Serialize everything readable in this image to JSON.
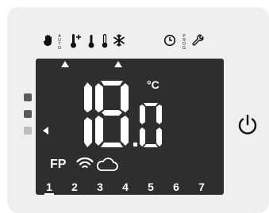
{
  "display": {
    "temperature_int": "18",
    "temperature_dec": "0",
    "unit": "°C",
    "mode_label": "FP",
    "icons": {
      "manual": "hand-icon",
      "auto": "auto-label",
      "comfort": "thermometer-plus-icon",
      "eco": "thermometer-icon",
      "thermo2": "thermometer-small-icon",
      "frost": "snowflake-icon",
      "clock": "clock-icon",
      "prog": "prog-label",
      "settings": "wrench-icon",
      "wifi": "wifi-icon",
      "cloud": "cloud-icon",
      "power": "power-icon"
    },
    "auto_text": "AUTO",
    "prog_text": "PROG"
  },
  "days": [
    {
      "label": "1",
      "active": true
    },
    {
      "label": "2",
      "active": false
    },
    {
      "label": "3",
      "active": false
    },
    {
      "label": "4",
      "active": false
    },
    {
      "label": "5",
      "active": false
    },
    {
      "label": "6",
      "active": false
    },
    {
      "label": "7",
      "active": false
    }
  ],
  "colors": {
    "screen": "#2e2e2e",
    "device": "#efefef",
    "segment": "#ffffff"
  }
}
